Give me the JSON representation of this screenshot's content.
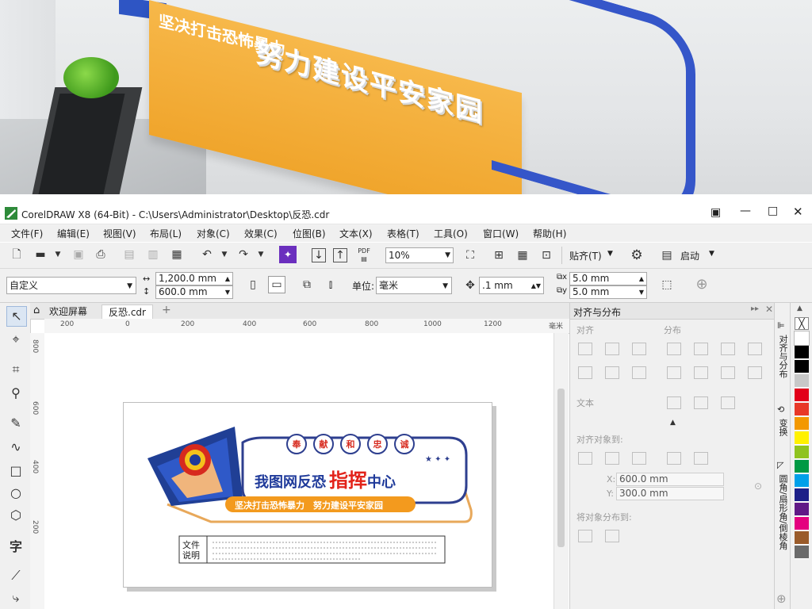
{
  "photo": {
    "slogan_small": "坚决打击恐怖暴力",
    "slogan_large": "努力建设平安家园"
  },
  "window": {
    "title": "CorelDRAW X8 (64-Bit) - C:\\Users\\Administrator\\Desktop\\反恐.cdr"
  },
  "menu": [
    "文件(F)",
    "编辑(E)",
    "视图(V)",
    "布局(L)",
    "对象(C)",
    "效果(C)",
    "位图(B)",
    "文本(X)",
    "表格(T)",
    "工具(O)",
    "窗口(W)",
    "帮助(H)"
  ],
  "toolbar1": {
    "zoom": "10%",
    "snap_label": "贴齐(T)",
    "launch_label": "启动"
  },
  "toolbar2": {
    "preset": "自定义",
    "width": "1,200.0 mm",
    "height": "600.0 mm",
    "units_label": "单位:",
    "units": "毫米",
    "nudge": ".1 mm",
    "dup_x": "5.0 mm",
    "dup_y": "5.0 mm"
  },
  "tabs": [
    "欢迎屏幕",
    "反恐.cdr"
  ],
  "ruler": {
    "h_labels": [
      "200",
      "0",
      "200",
      "400",
      "600",
      "800",
      "1000",
      "1200"
    ],
    "h_unit": "毫米",
    "v_labels": [
      "800",
      "600",
      "400",
      "200"
    ]
  },
  "design": {
    "badges": [
      "奉",
      "献",
      "和",
      "忠",
      "诚"
    ],
    "title_blue": "我图网反恐",
    "title_red": "指挥",
    "title_tail": "中心",
    "slogan": "坚决打击恐怖暴力　努力建设平安家园",
    "note_label": "文件说明"
  },
  "panel": {
    "title": "对齐与分布",
    "align": "对齐",
    "distribute": "分布",
    "text": "文本",
    "align_to": "对齐对象到:",
    "x_value": "600.0 mm",
    "y_value": "300.0 mm",
    "distribute_to": "将对象分布到:"
  },
  "dock_tabs": [
    "对齐与分布",
    "变换",
    "圆角/扇形角/倒棱角"
  ],
  "palette": [
    "#ffffff",
    "#000000",
    "#000000",
    "#c8c8c8",
    "#e2001a",
    "#e83828",
    "#f39800",
    "#fff100",
    "#8fc31f",
    "#009944",
    "#00a0e9",
    "#1d2088",
    "#601986",
    "#e4007f",
    "#9a5b2a",
    "#6a6a6a"
  ]
}
